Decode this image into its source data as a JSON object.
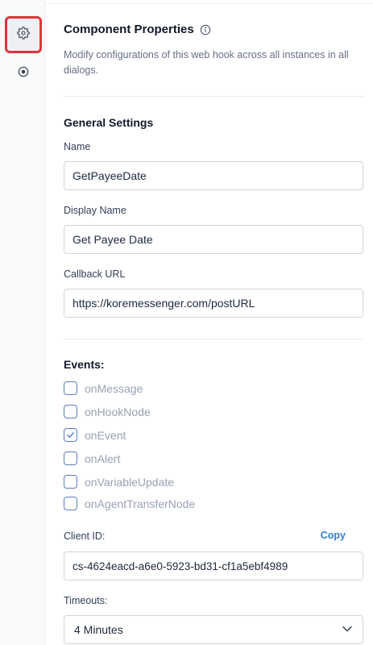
{
  "rail": {
    "items": [
      {
        "name": "settings",
        "icon": "gear-icon",
        "active": true
      },
      {
        "name": "connections",
        "icon": "target-icon",
        "active": false
      }
    ]
  },
  "header": {
    "title": "Component Properties",
    "description": "Modify configurations of this web hook across all instances in all dialogs."
  },
  "general": {
    "title": "General Settings",
    "name_label": "Name",
    "name_value": "GetPayeeDate",
    "display_name_label": "Display Name",
    "display_name_value": "Get Payee Date",
    "callback_label": "Callback URL",
    "callback_value": "https://koremessenger.com/postURL"
  },
  "events": {
    "title": "Events:",
    "items": [
      {
        "label": "onMessage",
        "checked": false
      },
      {
        "label": "onHookNode",
        "checked": false
      },
      {
        "label": "onEvent",
        "checked": true
      },
      {
        "label": "onAlert",
        "checked": false
      },
      {
        "label": "onVariableUpdate",
        "checked": false
      },
      {
        "label": "onAgentTransferNode",
        "checked": false
      }
    ]
  },
  "client": {
    "label": "Client ID:",
    "copy_label": "Copy",
    "value": "cs-4624eacd-a6e0-5923-bd31-cf1a5ebf4989"
  },
  "timeouts": {
    "label": "Timeouts:",
    "selected": "4 Minutes"
  },
  "colors": {
    "accent": "#2f80d1",
    "highlight": "#e0353b",
    "checkbox_border": "#5b7db8"
  }
}
